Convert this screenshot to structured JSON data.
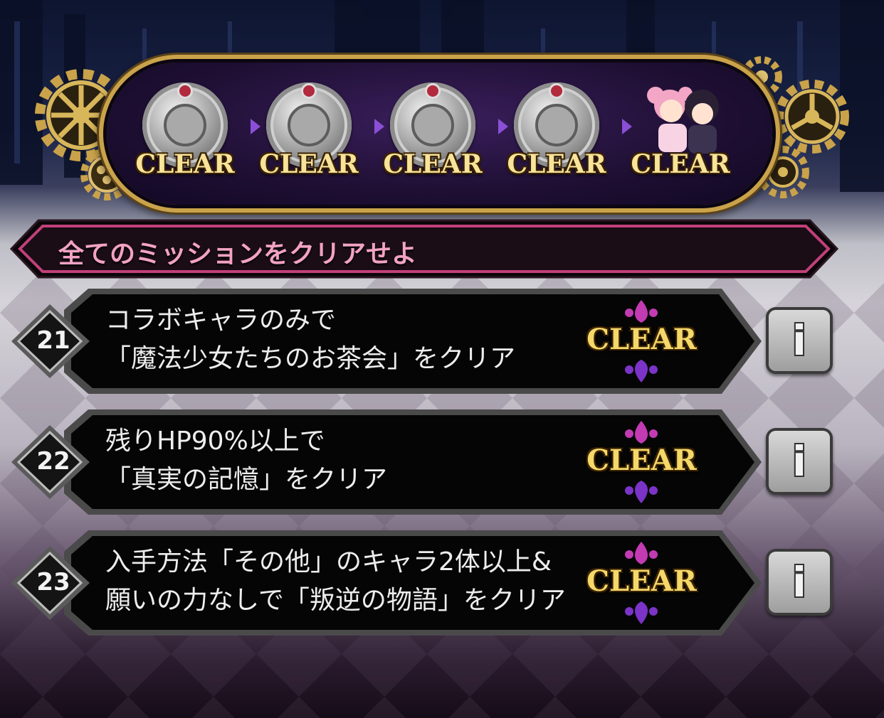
{
  "banner": {
    "steps": [
      {
        "label": "CLEAR"
      },
      {
        "label": "CLEAR"
      },
      {
        "label": "CLEAR"
      },
      {
        "label": "CLEAR"
      },
      {
        "label": "CLEAR"
      }
    ]
  },
  "section": {
    "title": "全てのミッションをクリアせよ"
  },
  "missions": [
    {
      "number": "21",
      "line1": "コラボキャラのみで",
      "line2": "「魔法少女たちのお茶会」をクリア",
      "status": "CLEAR",
      "info_icon": "i"
    },
    {
      "number": "22",
      "line1": "残りHP90%以上で",
      "line2": "「真実の記憶」をクリア",
      "status": "CLEAR",
      "info_icon": "i"
    },
    {
      "number": "23",
      "line1": "入手方法「その他」のキャラ2体以上&",
      "line2": "願いの力なしで「叛逆の物語」をクリア",
      "status": "CLEAR",
      "info_icon": "i"
    }
  ],
  "colors": {
    "gold": "#c9a24a",
    "banner_purple": "#1e0f33",
    "header_pink": "#c2407a",
    "clear_gold": "#f4d86a"
  }
}
